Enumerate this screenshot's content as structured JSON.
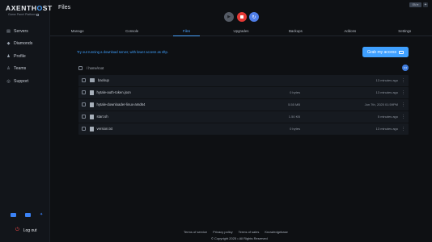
{
  "brand": {
    "name_left": "AXENT",
    "name_accent": "H",
    "name_o": "O",
    "name_right": "ST",
    "tagline": "Game Panel Platform"
  },
  "sidebar": {
    "items": [
      {
        "label": "Servers",
        "icon": "server-icon",
        "glyph": "▤"
      },
      {
        "label": "Diamonds",
        "icon": "diamond-icon",
        "glyph": "◆"
      },
      {
        "label": "Profile",
        "icon": "user-icon",
        "glyph": "♟"
      },
      {
        "label": "Teams",
        "icon": "users-icon",
        "glyph": "♙"
      },
      {
        "label": "Support",
        "icon": "support-icon",
        "glyph": "◎"
      }
    ],
    "socials": [
      "discord-icon",
      "mail-icon",
      "twitter-icon"
    ],
    "logout_label": "Log out"
  },
  "header": {
    "title": "Files",
    "locale_badge": "EN ▾",
    "plus": "+"
  },
  "power": {
    "start_glyph": "▶",
    "restart_glyph": "↻"
  },
  "tabs": [
    "Manage",
    "Console",
    "Files",
    "Upgrades",
    "Backups",
    "Addons",
    "Settings"
  ],
  "active_tab": "Files",
  "banner_text": "Try out running a download server, with lower access as sftp.",
  "sftp_button_label": "Grab my access",
  "breadcrumb": "/ home/root",
  "files": [
    {
      "name": "backup",
      "type": "folder",
      "size": "",
      "date": "13 minutes ago"
    },
    {
      "name": "hytale-auth-token.json",
      "type": "file",
      "size": "0 bytes",
      "date": "13 minutes ago"
    },
    {
      "name": "hytale-downloader-linux-amd64",
      "type": "file",
      "size": "5.55 MB",
      "date": "Jun 7th, 2025 01:59PM"
    },
    {
      "name": "start.sh",
      "type": "file",
      "size": "1.50 KB",
      "date": "5 minutes ago"
    },
    {
      "name": "version.txt",
      "type": "file",
      "size": "0 bytes",
      "date": "13 minutes ago"
    }
  ],
  "footer": {
    "links": [
      "Terms of service",
      "Privacy policy",
      "Terms of sales",
      "Knowledgebase"
    ],
    "copyright": "© Copyright 2025 • All Rights Reserved"
  },
  "colors": {
    "accent": "#3fa0ff",
    "stop": "#e53935",
    "restart": "#4f7ee8",
    "background": "#0e1013"
  }
}
